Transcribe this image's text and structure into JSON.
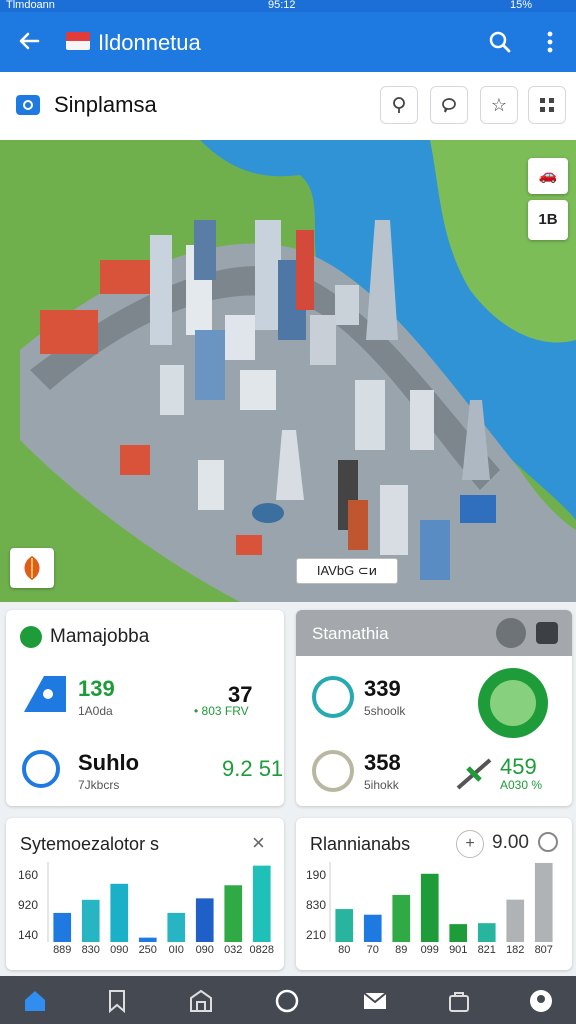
{
  "status": {
    "carrier": "Tlmdoann",
    "time": "95:12",
    "battery": "15%"
  },
  "appbar": {
    "title": "Ildonnetua",
    "back_icon": "arrow-left-icon",
    "search_icon": "search-icon",
    "more_icon": "more-vert-icon"
  },
  "subheader": {
    "place": "Sinplamsa",
    "buttons": [
      "pin-icon",
      "chat-pin-icon",
      "star-icon",
      "grid-icon"
    ]
  },
  "map": {
    "ctl_top": "🚗",
    "ctl_mid": "1B",
    "label": "IAVbG  ⊂ͷ"
  },
  "card1": {
    "title": "Mamajobba",
    "row1_value": "139",
    "row1_sub": "1A0da",
    "row1_right": "37",
    "row1_right_sub": "• 803 FRV",
    "row2_value": "Suhlo",
    "row2_sub": "7Jkbcrs",
    "row2_right": "9.2 51"
  },
  "card2": {
    "title": "Stamathia",
    "row1_value": "339",
    "row1_sub": "5shoolk",
    "row2_value": "358",
    "row2_sub": "5ihokk",
    "row2_right": "459",
    "row2_right_sub": "A030 %"
  },
  "card3": {
    "title": "Sytemoezalotor s",
    "close": "×",
    "ticks": [
      "160",
      "920",
      "140"
    ],
    "xlabels": [
      "889",
      "830",
      "090",
      "250",
      "0I0",
      "090",
      "032",
      "0828"
    ]
  },
  "card4": {
    "title": "Rlannianabs",
    "value": "9.00",
    "ticks": [
      "190",
      "830",
      "210"
    ],
    "xlabels": [
      "80",
      "70",
      "89",
      "099",
      "901",
      "821",
      "182",
      "807"
    ]
  },
  "chart_data": [
    {
      "type": "bar",
      "categories": [
        "889",
        "830",
        "090",
        "250",
        "0I0",
        "090",
        "032",
        "0828"
      ],
      "series": [
        {
          "values": [
            140,
            158,
            180,
            106,
            140,
            160,
            178,
            205
          ]
        }
      ],
      "ylim": [
        100,
        210
      ]
    },
    {
      "type": "bar",
      "categories": [
        "80",
        "70",
        "89",
        "099",
        "901",
        "821",
        "182",
        "807"
      ],
      "series": [
        {
          "values": [
            130,
            118,
            160,
            205,
            98,
            100,
            150,
            228
          ]
        }
      ],
      "ylim": [
        60,
        230
      ]
    }
  ],
  "colors": {
    "appbar": "#1e79e0",
    "accent_green": "#1e9c3a",
    "navbar": "#454a52"
  }
}
